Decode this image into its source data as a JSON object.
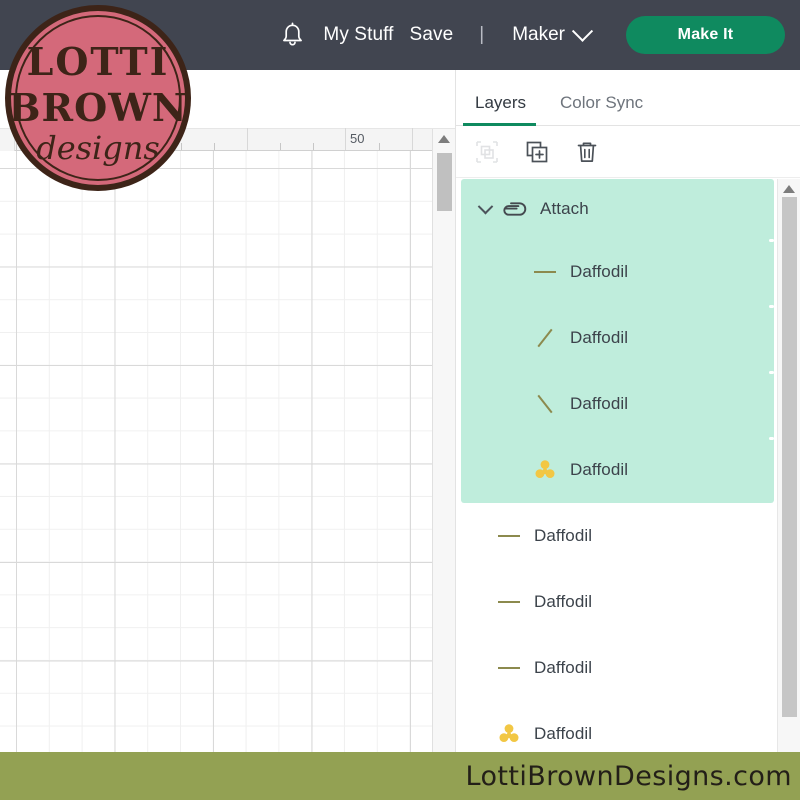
{
  "topbar": {
    "bell_icon": "bell-icon",
    "my_stuff": "My Stuff",
    "save": "Save",
    "separator": "|",
    "machine": "Maker",
    "machine_chevron": "chevron-down-icon",
    "make_it": "Make It",
    "bg_color": "#414550",
    "accent_color": "#0f8a5f"
  },
  "canvas": {
    "ruler_label_50": "50",
    "scroll_up_icon": "triangle-up-icon"
  },
  "panel": {
    "tabs": [
      {
        "label": "Layers",
        "active": true
      },
      {
        "label": "Color Sync",
        "active": false
      }
    ],
    "toolbar": [
      {
        "name": "group-icon",
        "disabled": true
      },
      {
        "name": "duplicate-icon",
        "disabled": false
      },
      {
        "name": "delete-icon",
        "disabled": false
      }
    ],
    "selected_bg": "#bfeddc",
    "group": {
      "chevron": "chevron-down-icon",
      "icon": "attach-icon",
      "label": "Attach",
      "children": [
        {
          "icon": "line-horizontal-icon",
          "label": "Daffodil"
        },
        {
          "icon": "line-diagonal-forward-icon",
          "label": "Daffodil"
        },
        {
          "icon": "line-diagonal-back-icon",
          "label": "Daffodil"
        },
        {
          "icon": "flower-icon",
          "label": "Daffodil"
        }
      ]
    },
    "layers": [
      {
        "icon": "line-horizontal-icon",
        "label": "Daffodil"
      },
      {
        "icon": "line-horizontal-icon",
        "label": "Daffodil"
      },
      {
        "icon": "line-horizontal-icon",
        "label": "Daffodil"
      },
      {
        "icon": "flower-icon",
        "label": "Daffodil"
      }
    ]
  },
  "logo": {
    "line1": "LOTTI",
    "line2": "BROWN",
    "line3": "designs",
    "bg_color": "#d4697a",
    "ink_color": "#3d2418"
  },
  "footer": {
    "text": "LottiBrownDesigns.com",
    "bg_color": "#93a153"
  }
}
